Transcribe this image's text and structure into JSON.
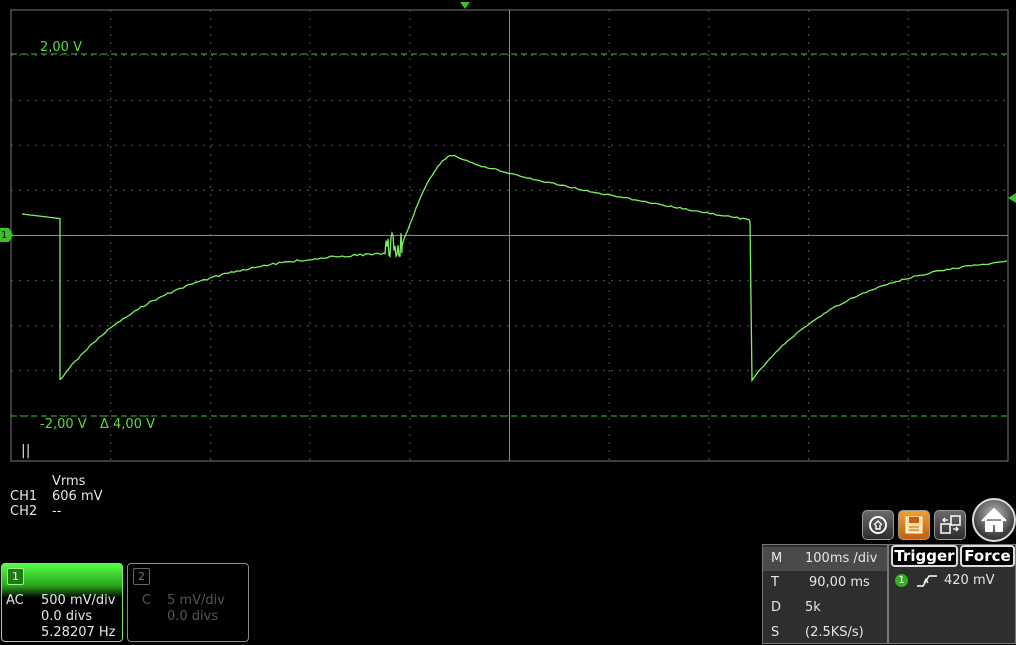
{
  "scope": {
    "upper_cursor_label": "2,00 V",
    "lower_cursor_label": "-2,00 V",
    "delta_label": "Δ 4,00 V",
    "run_indicator": "||",
    "channel_marker": "1",
    "trace_color": "#7af25e",
    "grid_color": "#555555"
  },
  "measurements": {
    "header": "Vrms",
    "rows": [
      {
        "channel": "CH1",
        "value": "606 mV"
      },
      {
        "channel": "CH2",
        "value": "--"
      }
    ]
  },
  "channels": [
    {
      "number": "1",
      "coupling": "AC",
      "scale": "500 mV/div",
      "offset": "0.0 divs",
      "freq": "5.28207 Hz"
    },
    {
      "number": "2",
      "coupling": "C",
      "scale": "5 mV/div",
      "offset": "0.0 divs",
      "freq": ""
    }
  ],
  "toolbar": {
    "icons": [
      "history-icon",
      "save-icon",
      "window-swap-icon",
      "home-icon"
    ]
  },
  "timebase": {
    "rows": [
      {
        "label": "M",
        "value": "100ms /div"
      },
      {
        "label": "T",
        "value": "90,00 ms"
      },
      {
        "label": "D",
        "value": "5k"
      },
      {
        "label": "S",
        "value": "(2.5KS/s)"
      }
    ]
  },
  "trigger": {
    "trigger_label": "Trigger",
    "force_label": "Force",
    "channel": "1",
    "level": "420 mV"
  }
}
